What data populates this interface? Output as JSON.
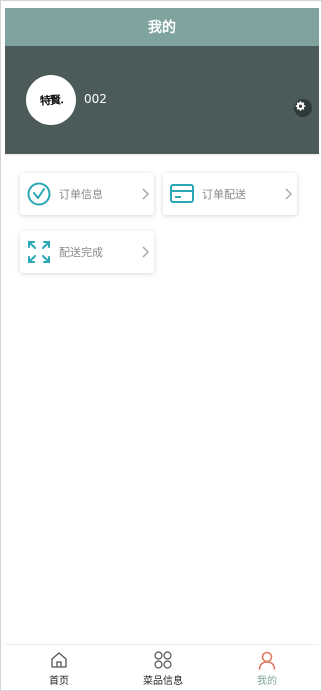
{
  "header": {
    "title": "我的"
  },
  "profile": {
    "avatar_text": "特賢.",
    "username": "002",
    "settings_icon": "gear-icon"
  },
  "menu": [
    {
      "label": "订单信息",
      "icon": "clock-check-icon"
    },
    {
      "label": "订单配送",
      "icon": "card-icon"
    },
    {
      "label": "配送完成",
      "icon": "expand-icon"
    }
  ],
  "tabbar": {
    "items": [
      {
        "label": "首页",
        "icon": "home-icon",
        "active": false
      },
      {
        "label": "菜品信息",
        "icon": "grid-icon",
        "active": false
      },
      {
        "label": "我的",
        "icon": "user-icon",
        "active": true
      }
    ]
  },
  "colors": {
    "header_bg": "#7fa39e",
    "profile_bg": "#4b5b59",
    "accent_icon": "#2aa7b5",
    "active_tab_icon": "#e07a5f"
  }
}
